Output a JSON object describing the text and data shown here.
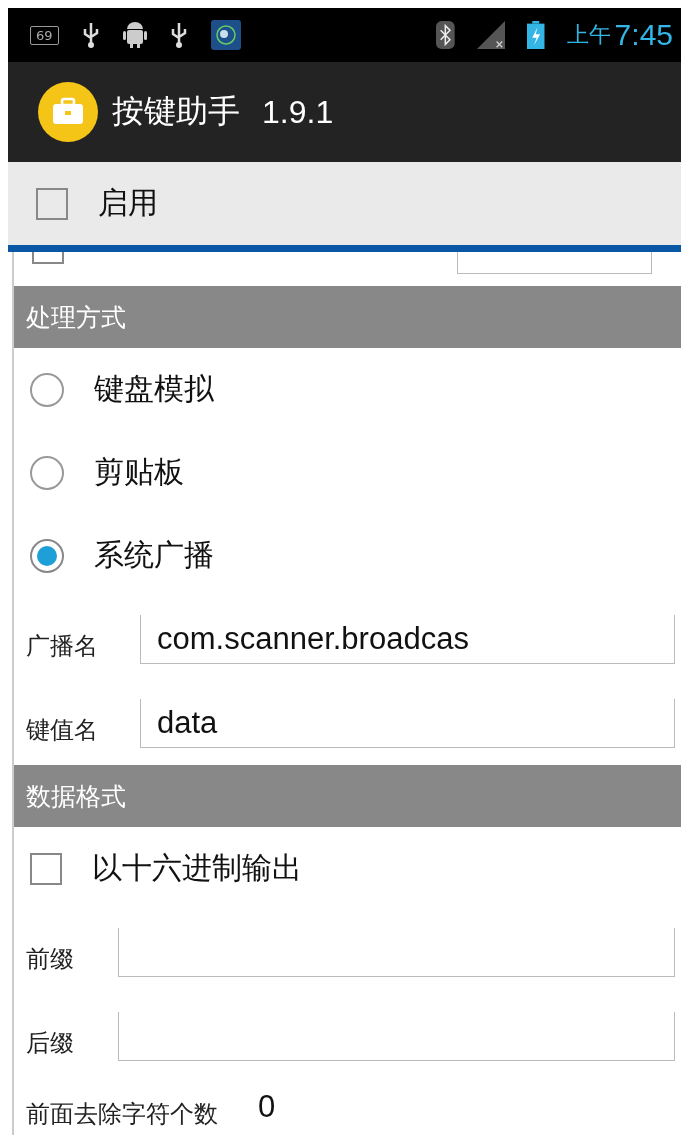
{
  "status_bar": {
    "badge": "69",
    "clock_period": "上午",
    "time": "7:45"
  },
  "app_bar": {
    "title": "按键助手",
    "version": "1.9.1"
  },
  "enable": {
    "label": "启用",
    "checked": false
  },
  "hidden_row": {
    "checked": false
  },
  "sections": [
    {
      "title": "处理方式",
      "items": [
        {
          "kind": "radio",
          "label": "键盘模拟",
          "selected": false
        },
        {
          "kind": "radio",
          "label": "剪贴板",
          "selected": false
        },
        {
          "kind": "radio",
          "label": "系统广播",
          "selected": true
        },
        {
          "kind": "field",
          "label": "广播名",
          "value": "com.scanner.broadcas"
        },
        {
          "kind": "field",
          "label": "键值名",
          "value": "data"
        }
      ]
    },
    {
      "title": "数据格式",
      "items": [
        {
          "kind": "checkbox",
          "label": "以十六进制输出",
          "checked": false
        },
        {
          "kind": "field",
          "label": "前缀"
        },
        {
          "kind": "field",
          "label": "后缀"
        },
        {
          "kind": "number",
          "label": "前面去除字符个数",
          "value": "0"
        }
      ]
    }
  ]
}
